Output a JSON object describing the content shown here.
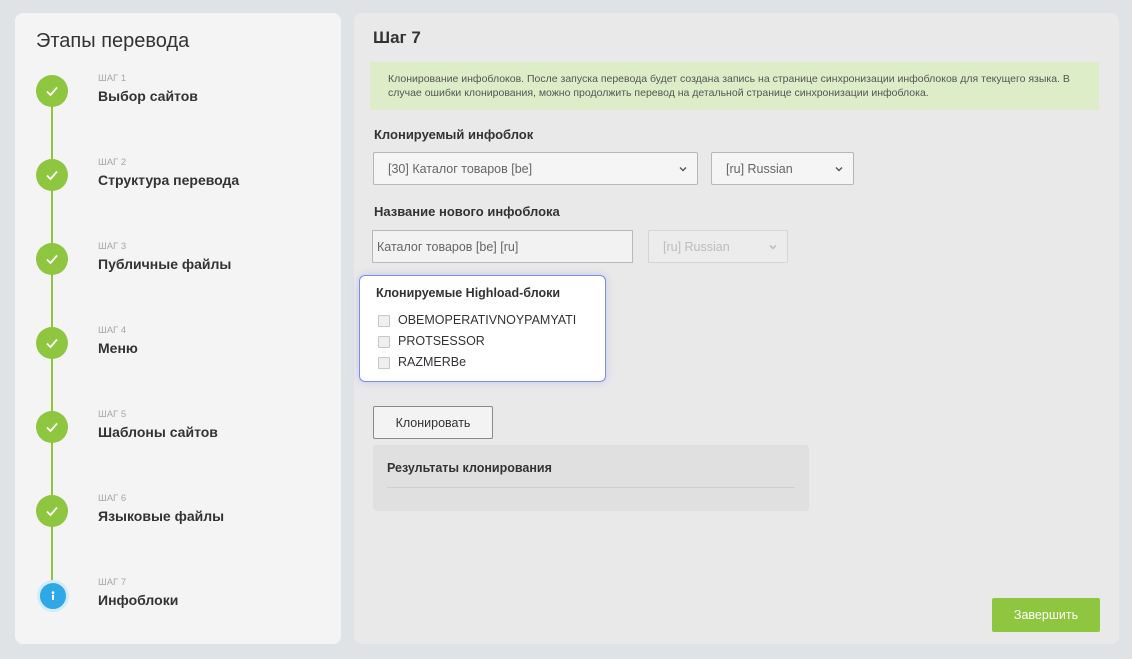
{
  "sidebar": {
    "title": "Этапы перевода",
    "steps": [
      {
        "num": "ШАГ 1",
        "title": "Выбор сайтов",
        "status": "done"
      },
      {
        "num": "ШАГ 2",
        "title": "Структура перевода",
        "status": "done"
      },
      {
        "num": "ШАГ 3",
        "title": "Публичные файлы",
        "status": "done"
      },
      {
        "num": "ШАГ 4",
        "title": "Меню",
        "status": "done"
      },
      {
        "num": "ШАГ 5",
        "title": "Шаблоны сайтов",
        "status": "done"
      },
      {
        "num": "ШАГ 6",
        "title": "Языковые файлы",
        "status": "done"
      },
      {
        "num": "ШАГ 7",
        "title": "Инфоблоки",
        "status": "current"
      }
    ]
  },
  "main": {
    "title": "Шаг 7",
    "notice": "Клонирование инфоблоков. После запуска перевода будет создана запись на странице синхронизации инфоблоков для текущего языка. В случае ошибки клонирования, можно продолжить перевод на детальной странице синхронизации инфоблока.",
    "cloned_iblock_label": "Клонируемый инфоблок",
    "iblock_select": "[30] Каталог товаров [be]",
    "lang_select": "[ru] Russian",
    "new_name_label": "Название нового инфоблока",
    "new_name_value": "Каталог товаров [be] [ru]",
    "new_lang_select": "[ru] Russian",
    "highload": {
      "title": "Клонируемые Highload-блоки",
      "items": [
        "OBEMOPERATIVNOYPAMYATI",
        "PROTSESSOR",
        "RAZMERBe"
      ]
    },
    "clone_button": "Клонировать",
    "results_title": "Результаты клонирования",
    "finish_button": "Завершить"
  },
  "colors": {
    "accent_green": "#8ec63f",
    "current_blue": "#2ea8e6",
    "notice_bg": "#dcedc8",
    "highlight_border": "#7b8de8"
  }
}
